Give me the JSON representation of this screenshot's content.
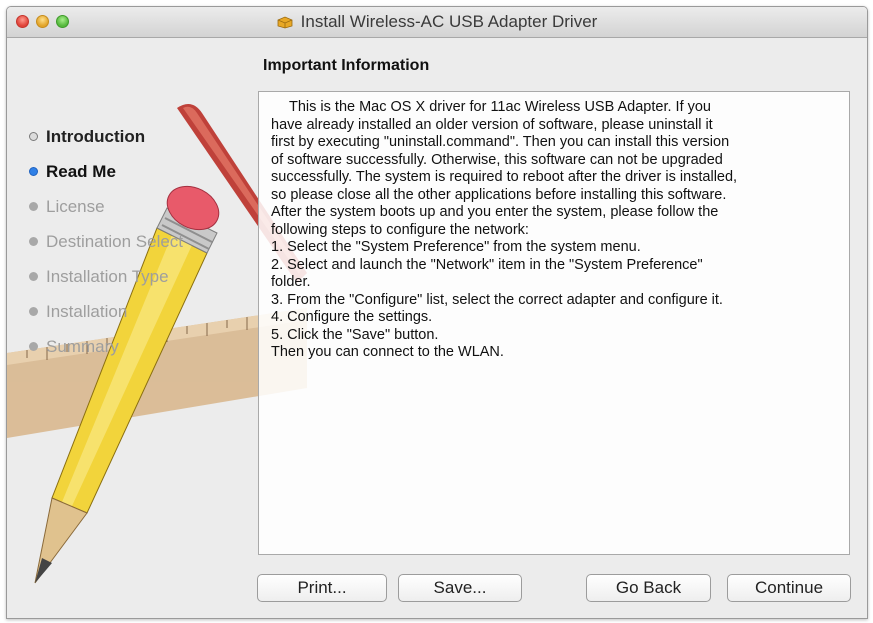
{
  "window": {
    "title": "Install Wireless-AC USB Adapter Driver"
  },
  "sidebar": {
    "steps": [
      {
        "label": "Introduction",
        "state": "done"
      },
      {
        "label": "Read Me",
        "state": "active"
      },
      {
        "label": "License",
        "state": "future"
      },
      {
        "label": "Destination Select",
        "state": "future"
      },
      {
        "label": "Installation Type",
        "state": "future"
      },
      {
        "label": "Installation",
        "state": "future"
      },
      {
        "label": "Summary",
        "state": "future"
      }
    ]
  },
  "main": {
    "heading": "Important Information",
    "lines": [
      "This is the Mac OS X driver for 11ac Wireless USB Adapter. If you",
      "have already installed an older version of software, please uninstall it",
      "first by executing \"uninstall.command\". Then you can install this version",
      "of software successfully. Otherwise, this software can not be upgraded",
      "successfully. The system is required to reboot after the driver is installed,",
      "so please close all the other applications before installing this software.",
      "After the system boots up and you enter the system, please follow the",
      "following steps to configure the network:",
      "1. Select the \"System Preference\" from the system menu.",
      "2. Select and launch the \"Network\" item in the \"System Preference\"",
      "folder.",
      "3. From the \"Configure\" list, select the correct adapter and configure it.",
      "4. Configure the settings.",
      "5. Click the \"Save\" button.",
      "Then you can connect to the WLAN."
    ]
  },
  "buttons": {
    "print": "Print...",
    "save": "Save...",
    "go_back": "Go Back",
    "continue": "Continue"
  },
  "colors": {
    "active_step": "#2f80e6",
    "window_bg": "#ececec"
  }
}
